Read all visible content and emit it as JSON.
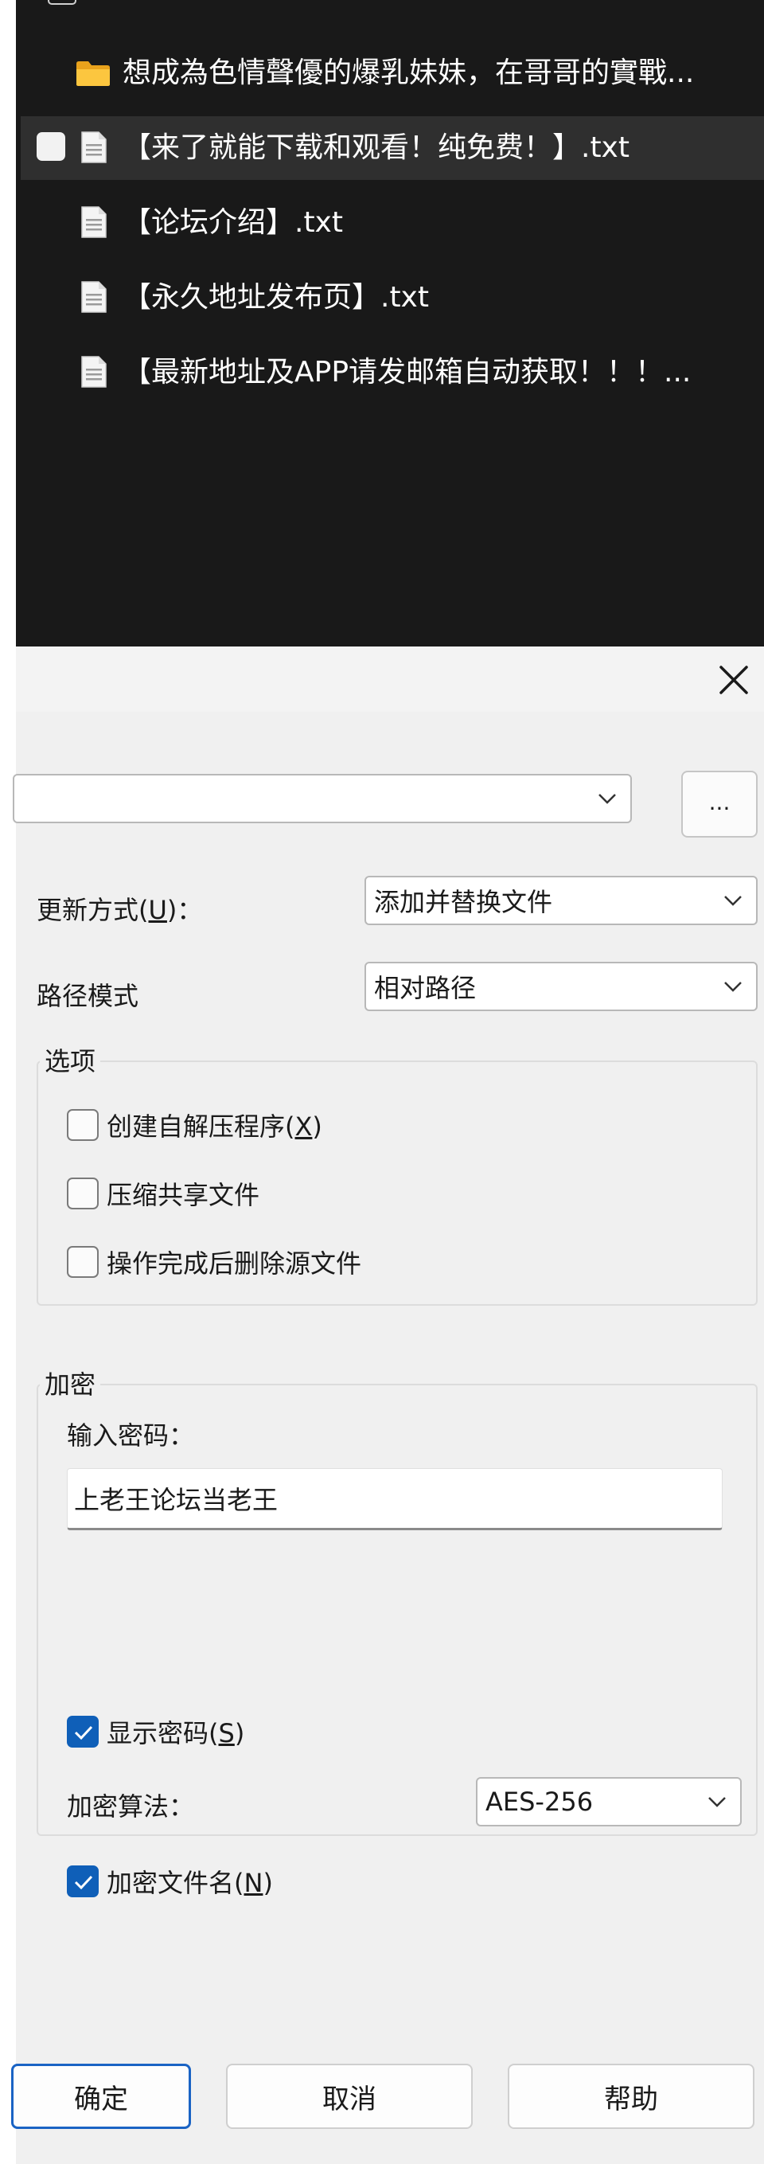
{
  "explorer": {
    "files": [
      {
        "name": "想成為色情聲優的爆乳妹妹，在哥哥的實戰...",
        "type": "folder",
        "selected": false
      },
      {
        "name": "【来了就能下载和观看！纯免费！】.txt",
        "type": "file",
        "selected": true
      },
      {
        "name": "【论坛介绍】.txt",
        "type": "file",
        "selected": false
      },
      {
        "name": "【永久地址发布页】.txt",
        "type": "file",
        "selected": false
      },
      {
        "name": "【最新地址及APP请发邮箱自动获取！！！...",
        "type": "file",
        "selected": false
      }
    ]
  },
  "dialog": {
    "archive_path_value": "",
    "browse_label": "...",
    "update_mode": {
      "label": "更新方式(",
      "hotkey": "U",
      "suffix": ")：",
      "value": "添加并替换文件"
    },
    "path_mode": {
      "label": "路径模式",
      "value": "相对路径"
    },
    "options": {
      "title": "选项",
      "items": [
        {
          "text": "创建自解压程序(",
          "hotkey": "X",
          "suffix": ")",
          "checked": false
        },
        {
          "text": "压缩共享文件",
          "hotkey": "",
          "suffix": "",
          "checked": false
        },
        {
          "text": "操作完成后删除源文件",
          "hotkey": "",
          "suffix": "",
          "checked": false
        }
      ]
    },
    "encryption": {
      "title": "加密",
      "password_label": "输入密码：",
      "password_value": "上老王论坛当老王",
      "show_password": {
        "text": "显示密码(",
        "hotkey": "S",
        "suffix": ")",
        "checked": true
      },
      "algorithm_label": "加密算法：",
      "algorithm_value": "AES-256",
      "encrypt_names": {
        "text": "加密文件名(",
        "hotkey": "N",
        "suffix": ")",
        "checked": true
      }
    },
    "buttons": {
      "ok": "确定",
      "cancel": "取消",
      "help": "帮助"
    }
  },
  "colors": {
    "explorer_bg": "#191919",
    "selected_row": "#2f2f2f",
    "accent": "#0f5fb8",
    "dialog_bg": "#f0f0f0"
  }
}
